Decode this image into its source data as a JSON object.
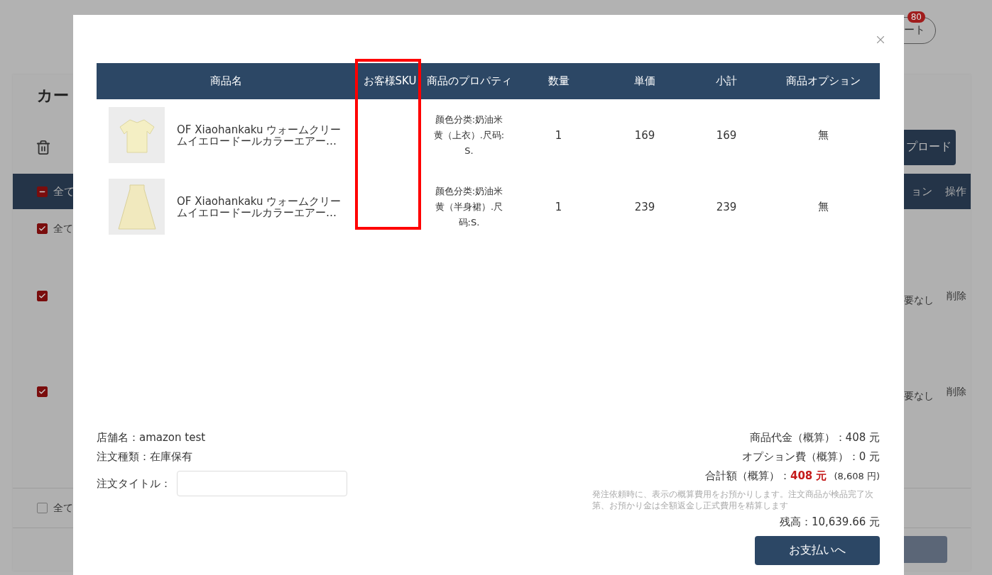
{
  "page": {
    "title": "カー",
    "cart_button": {
      "label": "ート",
      "badge": "80"
    },
    "upload_button": "プロード",
    "table_header": {
      "select_all": {
        "label": "全て",
        "indeterminate": true
      },
      "column_option": "ョン",
      "column_actions": "操作"
    },
    "store_row": {
      "label": "全て",
      "checked": true
    },
    "rows": [
      {
        "checked": true,
        "status": "要なし",
        "action": "削除"
      },
      {
        "checked": true,
        "status": "要なし",
        "action": "削除"
      }
    ],
    "footer": {
      "select_all": {
        "label": "全て",
        "checked": false
      }
    }
  },
  "modal": {
    "columns": [
      "商品名",
      "お客様SKU",
      "商品のプロパティ",
      "数量",
      "単価",
      "小計",
      "商品オプション"
    ],
    "items": [
      {
        "name": "OF Xiaohankaku ウォームクリームイエロードールカラーエアー…",
        "properties": "颜色分类:奶油米黄（上衣）.尺码:S.",
        "quantity": "1",
        "unit_price": "169",
        "subtotal": "169",
        "option": "無"
      },
      {
        "name": "OF Xiaohankaku ウォームクリームイエロードールカラーエアー…",
        "properties": "颜色分类:奶油米黄（半身裙）.尺码:S.",
        "quantity": "1",
        "unit_price": "239",
        "subtotal": "239",
        "option": "無"
      }
    ],
    "shop_name": "店舗名：amazon test",
    "order_type": "注文種類：在庫保有",
    "order_title_label": "注文タイトル：",
    "goods_total": "商品代金（概算）：408 元",
    "option_fee": "オプション費（概算）：0 元",
    "total_label": "合計額（概算）：",
    "total_value": "408 元",
    "total_jpy": "(8,608 円)",
    "note": "発注依頼時に、表示の概算費用をお預かりします。注文商品が検品完了次第、お預かり金は全額返金し正式費用を精算します",
    "balance": "残高：10,639.66 元",
    "pay_button": "お支払いへ"
  }
}
